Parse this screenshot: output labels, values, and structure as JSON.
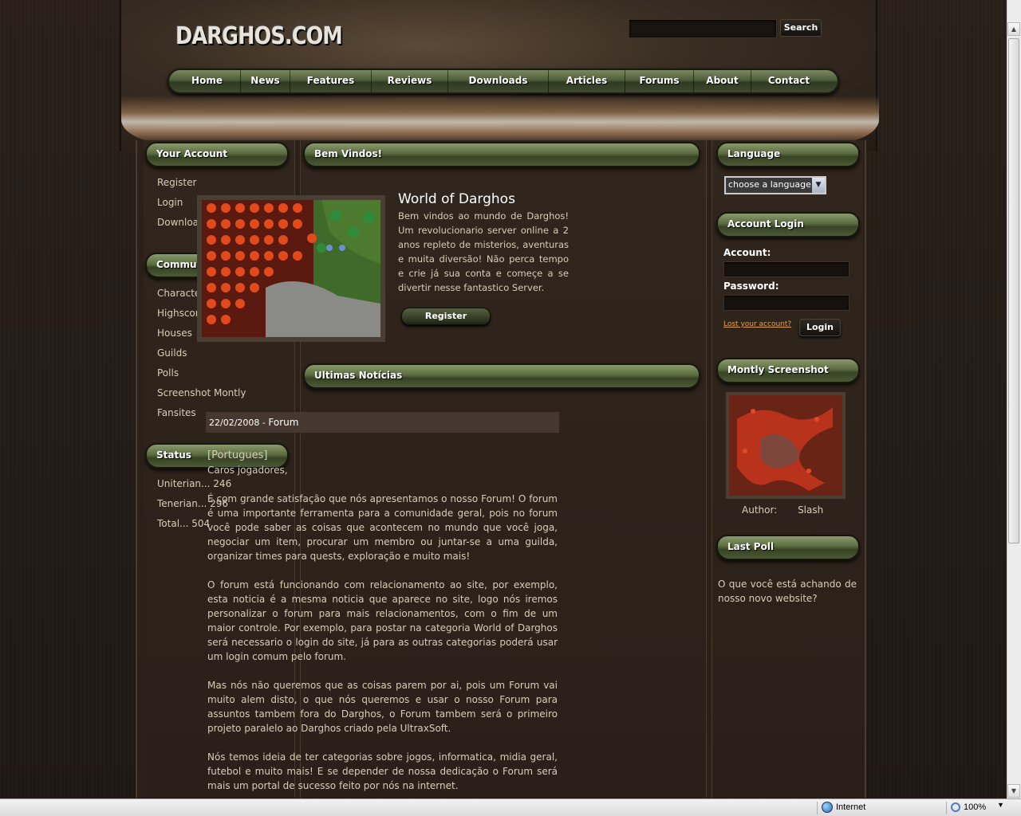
{
  "site": {
    "logo": "DARGHOS.COM",
    "search_button": "Search"
  },
  "nav": [
    "Home",
    "News",
    "Features",
    "Reviews",
    "Downloads",
    "Articles",
    "Forums",
    "About",
    "Contact"
  ],
  "left": {
    "account_title": "Your Account",
    "account_items": [
      "Register",
      "Login",
      "Download Client"
    ],
    "community_title": "Community",
    "community_items": [
      "Characters",
      "Highscores",
      "Houses",
      "Guilds",
      "Polls",
      "Screenshot Montly",
      "Fansites"
    ],
    "status_title": "Status",
    "status_items": [
      "Uniterian... 246",
      "Tenerian... 296",
      "Total... 504"
    ]
  },
  "main": {
    "welcome_title": "Bem Vindos!",
    "heading": "World of Darghos",
    "intro": "Bem vindos ao mundo de Darghos! Um revolucionario server online a 2 anos repleto de misterios, aventuras e muita diversão! Não perca tempo e crie já sua conta e começe a se divertir nesse fantastico Server.",
    "register_button": "Register",
    "news_title": "Ultimas Notícias",
    "news_date": "22/02/2008",
    "news_category": "Forum",
    "news_tag": "[Portugues]",
    "news_greeting": "Caros jogadores,",
    "news_paragraphs": [
      "É com grande satisfação que nós apresentamos o nosso Forum! O forum é uma importante ferramenta para a comunidade geral, pois no forum você pode saber as coisas que acontecem no mundo que você joga, negociar um item, procurar um membro ou juntar-se a uma guilda, organizar times para quests, exploração e muito mais!",
      "O forum está funcionando com relacionamento ao site, por exemplo, esta noticia é a mesma noticia que aparece no site, logo nós iremos personalizar o forum para mais relacionamentos, com o fim de um maior controle. Por exemplo, para postar na categoria World of Darghos será necessario o login do site, já para as outras categorias poderá usar um login comum pelo forum.",
      "Mas nós não queremos que as coisas parem por ai, pois um Forum vai muito alem disto, o que nós queremos e usar o nosso Forum para assuntos tambem fora do Darghos, o Forum tambem será o primeiro projeto paralelo ao Darghos criado pela UltraxSoft.",
      "Nós temos ideia de ter categorias sobre jogos, informatica, midia geral, futebol e muito mais! E se depender de nossa dedicação o Forum será mais um portal de sucesso feito por nós na internet."
    ]
  },
  "right": {
    "language_title": "Language",
    "language_select": "choose a language",
    "login_title": "Account Login",
    "account_label": "Account:",
    "password_label": "Password:",
    "lost_link": "Lost your account?",
    "login_button": "Login",
    "screenshot_title": "Montly Screenshot",
    "author_label": "Author:",
    "author_name": "Slash",
    "poll_title": "Last Poll",
    "poll_question": "O que você está achando de nosso novo website?"
  },
  "browser": {
    "zone": "Internet",
    "zoom": "100%"
  }
}
